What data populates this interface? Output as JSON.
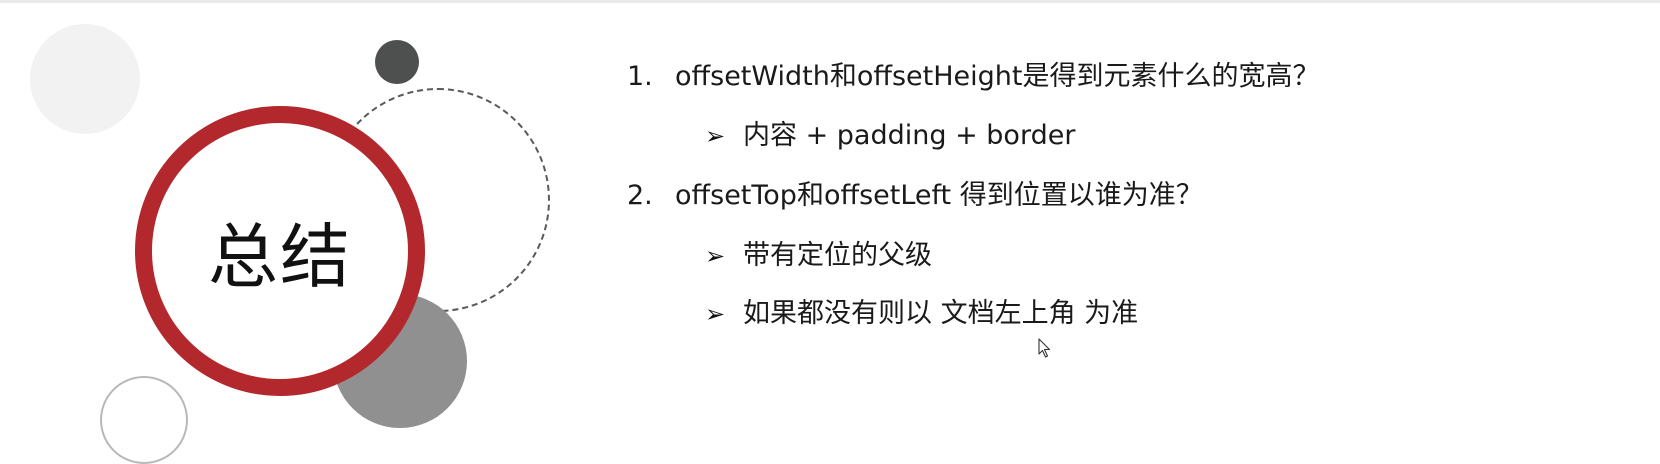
{
  "slide": {
    "title": "总结",
    "items": [
      {
        "number": "1.",
        "question": "offsetWidth和offsetHeight是得到元素什么的宽高？",
        "answers": [
          "内容 + padding +  border"
        ]
      },
      {
        "number": "2.",
        "question": "offsetTop和offsetLeft 得到位置以谁为准？",
        "answers": [
          "带有定位的父级",
          "如果都没有则以 文档左上角 为准"
        ]
      }
    ],
    "bullet_glyph": "➢"
  },
  "colors": {
    "accent_ring": "#b3282d",
    "dark_circle": "#4d504f",
    "gray_circle": "#909090",
    "light_circle": "#f2f2f2"
  },
  "icons": {
    "cursor": "mouse-pointer-icon",
    "bullet": "arrowhead-bullet-icon"
  }
}
